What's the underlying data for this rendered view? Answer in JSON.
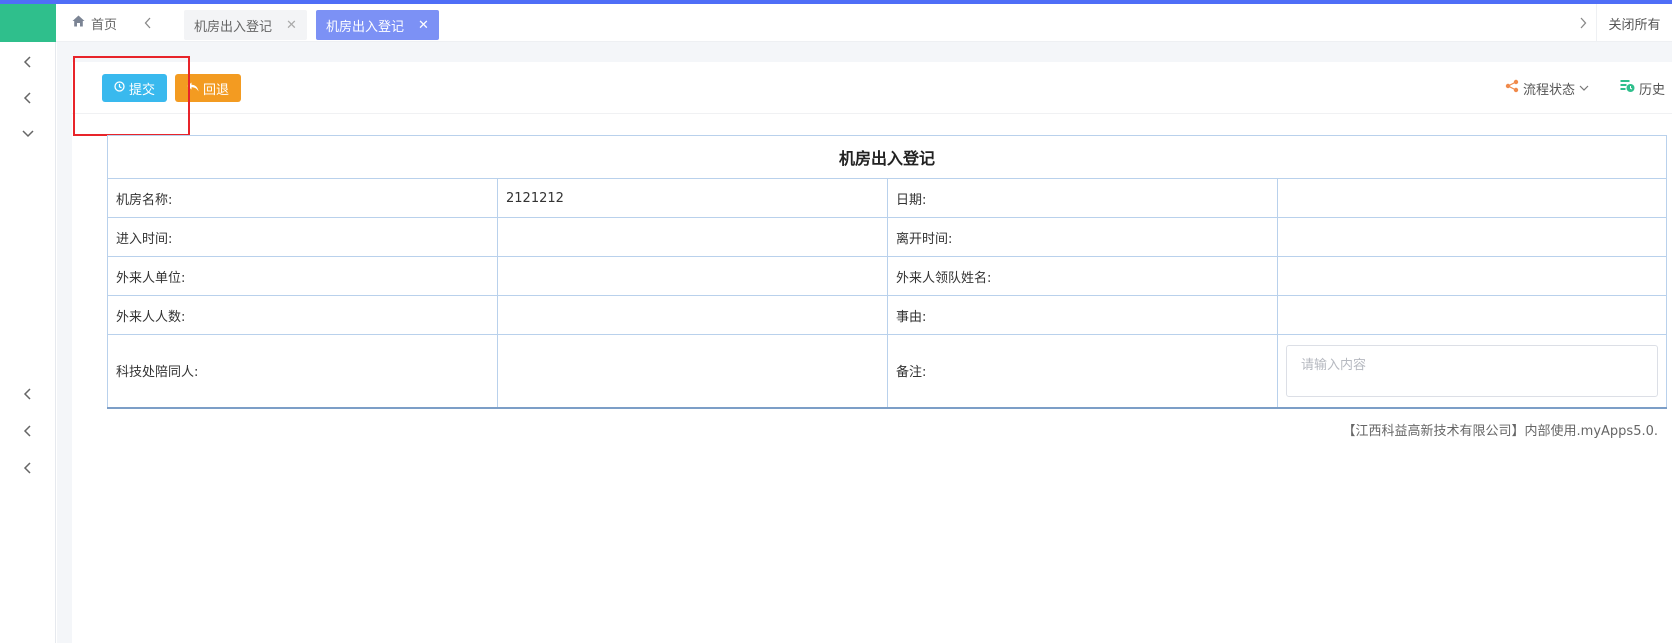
{
  "tabs": {
    "home_label": "首页",
    "items": [
      {
        "label": "机房出入登记"
      },
      {
        "label": "机房出入登记"
      }
    ],
    "close_all_label": "关闭所有"
  },
  "toolbar": {
    "submit_label": "提交",
    "rollback_label": "回退",
    "flow_status_label": "流程状态",
    "history_label": "历史"
  },
  "form": {
    "title": "机房出入登记",
    "fields": {
      "room_name_label": "机房名称:",
      "room_name_value": "2121212",
      "date_label": "日期:",
      "date_value": "",
      "enter_time_label": "进入时间:",
      "enter_time_value": "",
      "leave_time_label": "离开时间:",
      "leave_time_value": "",
      "visitor_unit_label": "外来人单位:",
      "visitor_unit_value": "",
      "visitor_leader_label": "外来人领队姓名:",
      "visitor_leader_value": "",
      "visitor_count_label": "外来人人数:",
      "visitor_count_value": "",
      "reason_label": "事由:",
      "reason_value": "",
      "escort_label": "科技处陪同人:",
      "escort_value": "",
      "remark_label": "备注:",
      "remark_placeholder": "请输入内容"
    }
  },
  "footer": {
    "text": "【江西科益高新技术有限公司】内部使用.myApps5.0."
  },
  "colors": {
    "accent": "#4f6ef7",
    "logo": "#2fbf8c",
    "active_tab": "#7c91f5",
    "submit": "#39b9ee",
    "rollback": "#f39b21",
    "highlight": "#e8242a",
    "table_border": "#b9d1ec"
  },
  "icons": {
    "home": "home-icon",
    "submit": "clock-icon",
    "rollback": "undo-icon",
    "flow_status": "share-nodes-icon",
    "history": "history-icon"
  }
}
